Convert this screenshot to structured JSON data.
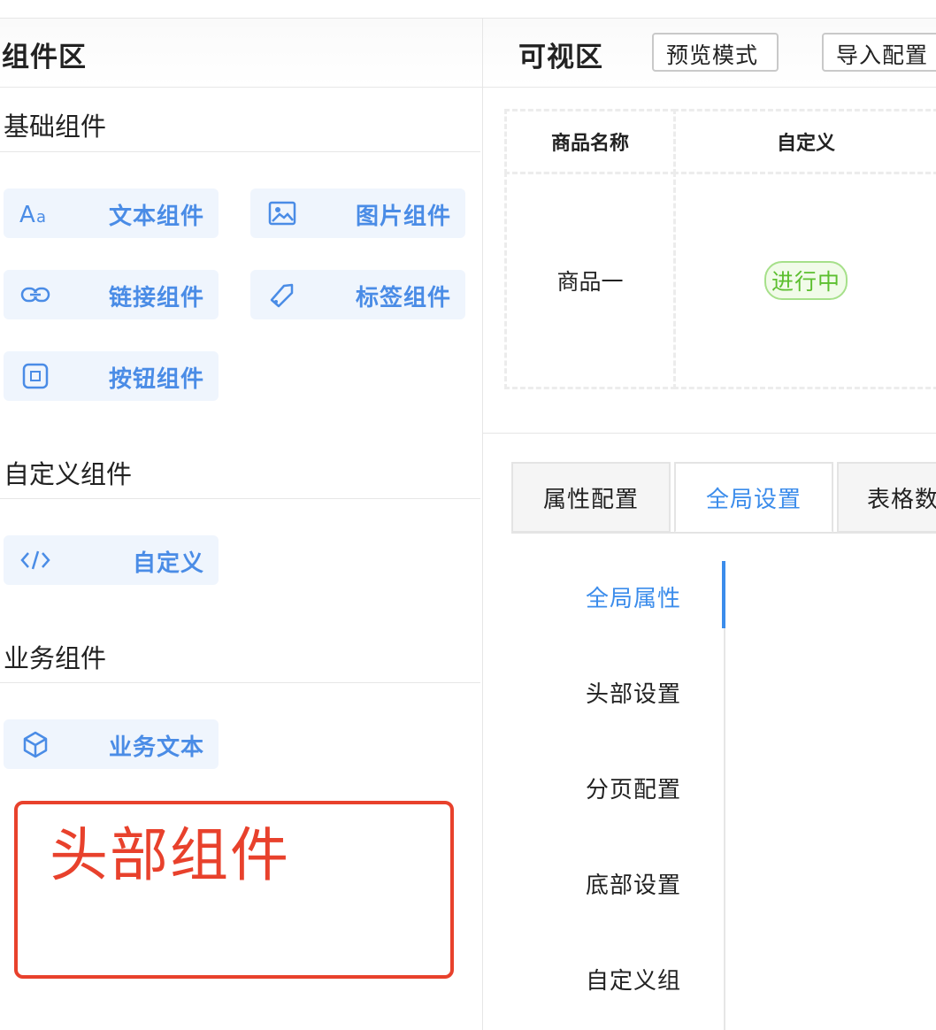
{
  "left_panel": {
    "title": "组件区",
    "sections": [
      {
        "title": "基础组件"
      },
      {
        "title": "自定义组件"
      },
      {
        "title": "业务组件"
      }
    ],
    "components": [
      {
        "label": "文本组件",
        "icon": "text-icon"
      },
      {
        "label": "图片组件",
        "icon": "image-icon"
      },
      {
        "label": "链接组件",
        "icon": "link-icon"
      },
      {
        "label": "标签组件",
        "icon": "tag-icon"
      },
      {
        "label": "按钮组件",
        "icon": "button-icon"
      },
      {
        "label": "自定义",
        "icon": "code-icon"
      },
      {
        "label": "业务文本",
        "icon": "cube-icon"
      }
    ],
    "annotation": "头部组件"
  },
  "right_panel": {
    "title": "可视区",
    "preview_btn": "预览模式",
    "import_btn": "导入配置",
    "table": {
      "headers": [
        "商品名称",
        "自定义"
      ],
      "rows": [
        {
          "name": "商品一",
          "status": "进行中"
        }
      ]
    },
    "tabs": [
      {
        "label": "属性配置"
      },
      {
        "label": "全局设置",
        "active": true
      },
      {
        "label": "表格数"
      }
    ],
    "menu": [
      {
        "label": "全局属性",
        "active": true
      },
      {
        "label": "头部设置"
      },
      {
        "label": "分页配置"
      },
      {
        "label": "底部设置"
      },
      {
        "label": "自定义组"
      }
    ]
  },
  "colors": {
    "accent": "#3b8ceb",
    "component_bg": "#eff5fd",
    "annotation": "#e8412c",
    "tag_green": "#5cbf2f"
  }
}
